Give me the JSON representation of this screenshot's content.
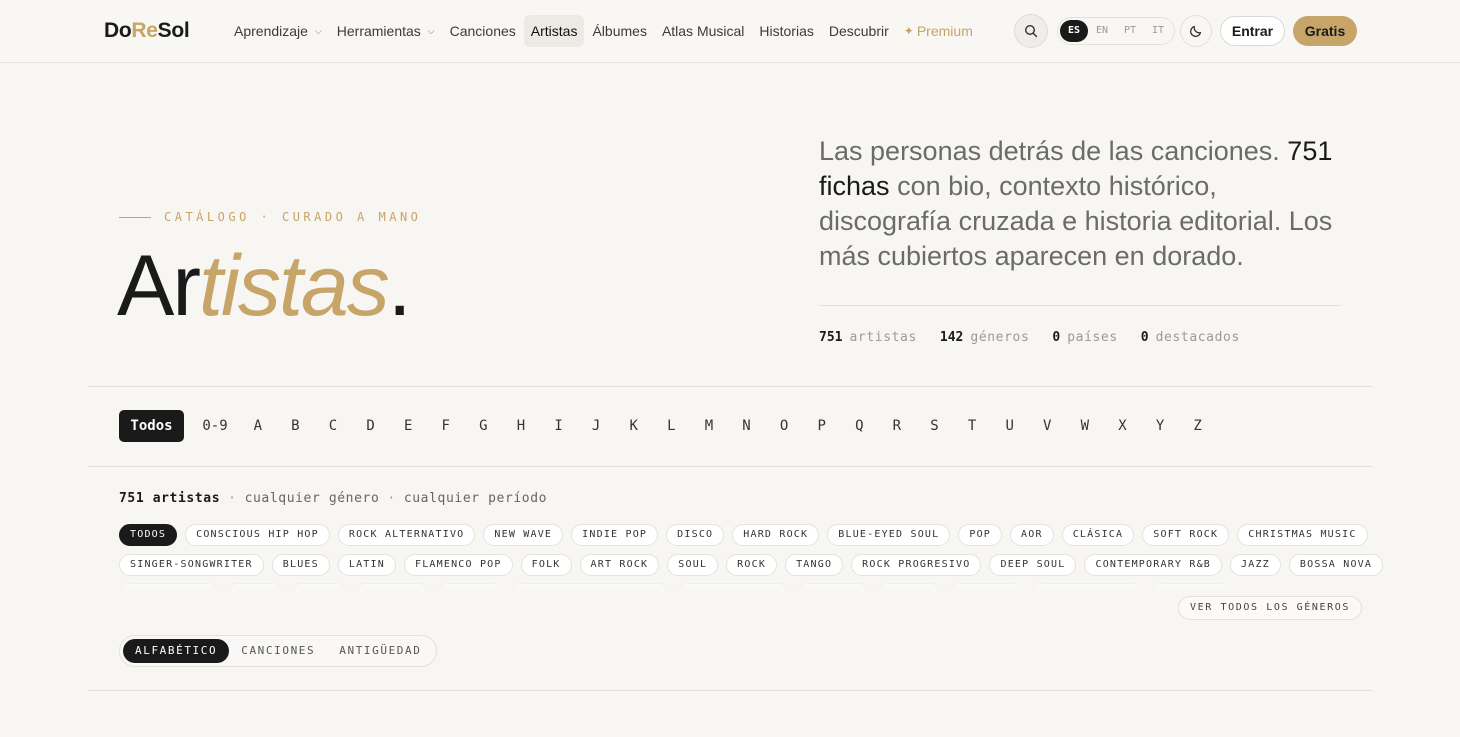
{
  "header": {
    "logo": {
      "part1": "Do",
      "part2": "Re",
      "part3": "Sol"
    },
    "nav": [
      {
        "label": "Aprendizaje",
        "dropdown": true
      },
      {
        "label": "Herramientas",
        "dropdown": true
      },
      {
        "label": "Canciones"
      },
      {
        "label": "Artistas",
        "active": true
      },
      {
        "label": "Álbumes"
      },
      {
        "label": "Atlas Musical"
      },
      {
        "label": "Historias"
      },
      {
        "label": "Descubrir"
      }
    ],
    "premium_label": "Premium",
    "languages": [
      "ES",
      "EN",
      "PT",
      "IT"
    ],
    "active_language": "ES",
    "login_label": "Entrar",
    "free_label": "Gratis"
  },
  "hero": {
    "eyebrow": "CATÁLOGO · CURADO A MANO",
    "title_plain": "Ar",
    "title_italic": "tistas",
    "title_end": ".",
    "intro_pre": "Las personas detrás de las canciones.",
    "intro_strong": "751 fichas",
    "intro_post": "con bio, contexto histórico, discografía cruzada e historia editorial. Los más cubiertos aparecen en dorado.",
    "stats": [
      {
        "num": "751",
        "label": "artistas"
      },
      {
        "num": "142",
        "label": "géneros"
      },
      {
        "num": "0",
        "label": "países"
      },
      {
        "num": "0",
        "label": "destacados"
      }
    ]
  },
  "alphabet": {
    "all_label": "Todos",
    "num_label": "0-9",
    "letters": [
      "A",
      "B",
      "C",
      "D",
      "E",
      "F",
      "G",
      "H",
      "I",
      "J",
      "K",
      "L",
      "M",
      "N",
      "O",
      "P",
      "Q",
      "R",
      "S",
      "T",
      "U",
      "V",
      "W",
      "X",
      "Y",
      "Z"
    ]
  },
  "summary": {
    "count": "751 artistas",
    "genre": "cualquier género",
    "period": "cualquier período"
  },
  "genres_row1": [
    "TODOS",
    "CONSCIOUS HIP HOP",
    "ROCK ALTERNATIVO",
    "NEW WAVE",
    "INDIE POP",
    "DISCO",
    "HARD ROCK",
    "BLUE-EYED SOUL",
    "POP",
    "AOR",
    "CLÁSICA",
    "SOFT ROCK",
    "CHRISTMAS MUSIC"
  ],
  "genres_row2": [
    "SINGER-SONGWRITER",
    "BLUES",
    "LATIN",
    "FLAMENCO POP",
    "FOLK",
    "ART ROCK",
    "SOUL",
    "ROCK",
    "TANGO",
    "ROCK PROGRESIVO",
    "DEEP SOUL",
    "CONTEMPORARY R&B",
    "JAZZ",
    "BOSSA NOVA"
  ],
  "see_all_label": "VER TODOS LOS GÉNEROS",
  "sort_options": [
    "ALFABÉTICO",
    "CANCIONES",
    "ANTIGÜEDAD"
  ],
  "colors": {
    "accent": "#c7a468",
    "ink": "#1a1a1a",
    "background": "#f7f6f3"
  }
}
